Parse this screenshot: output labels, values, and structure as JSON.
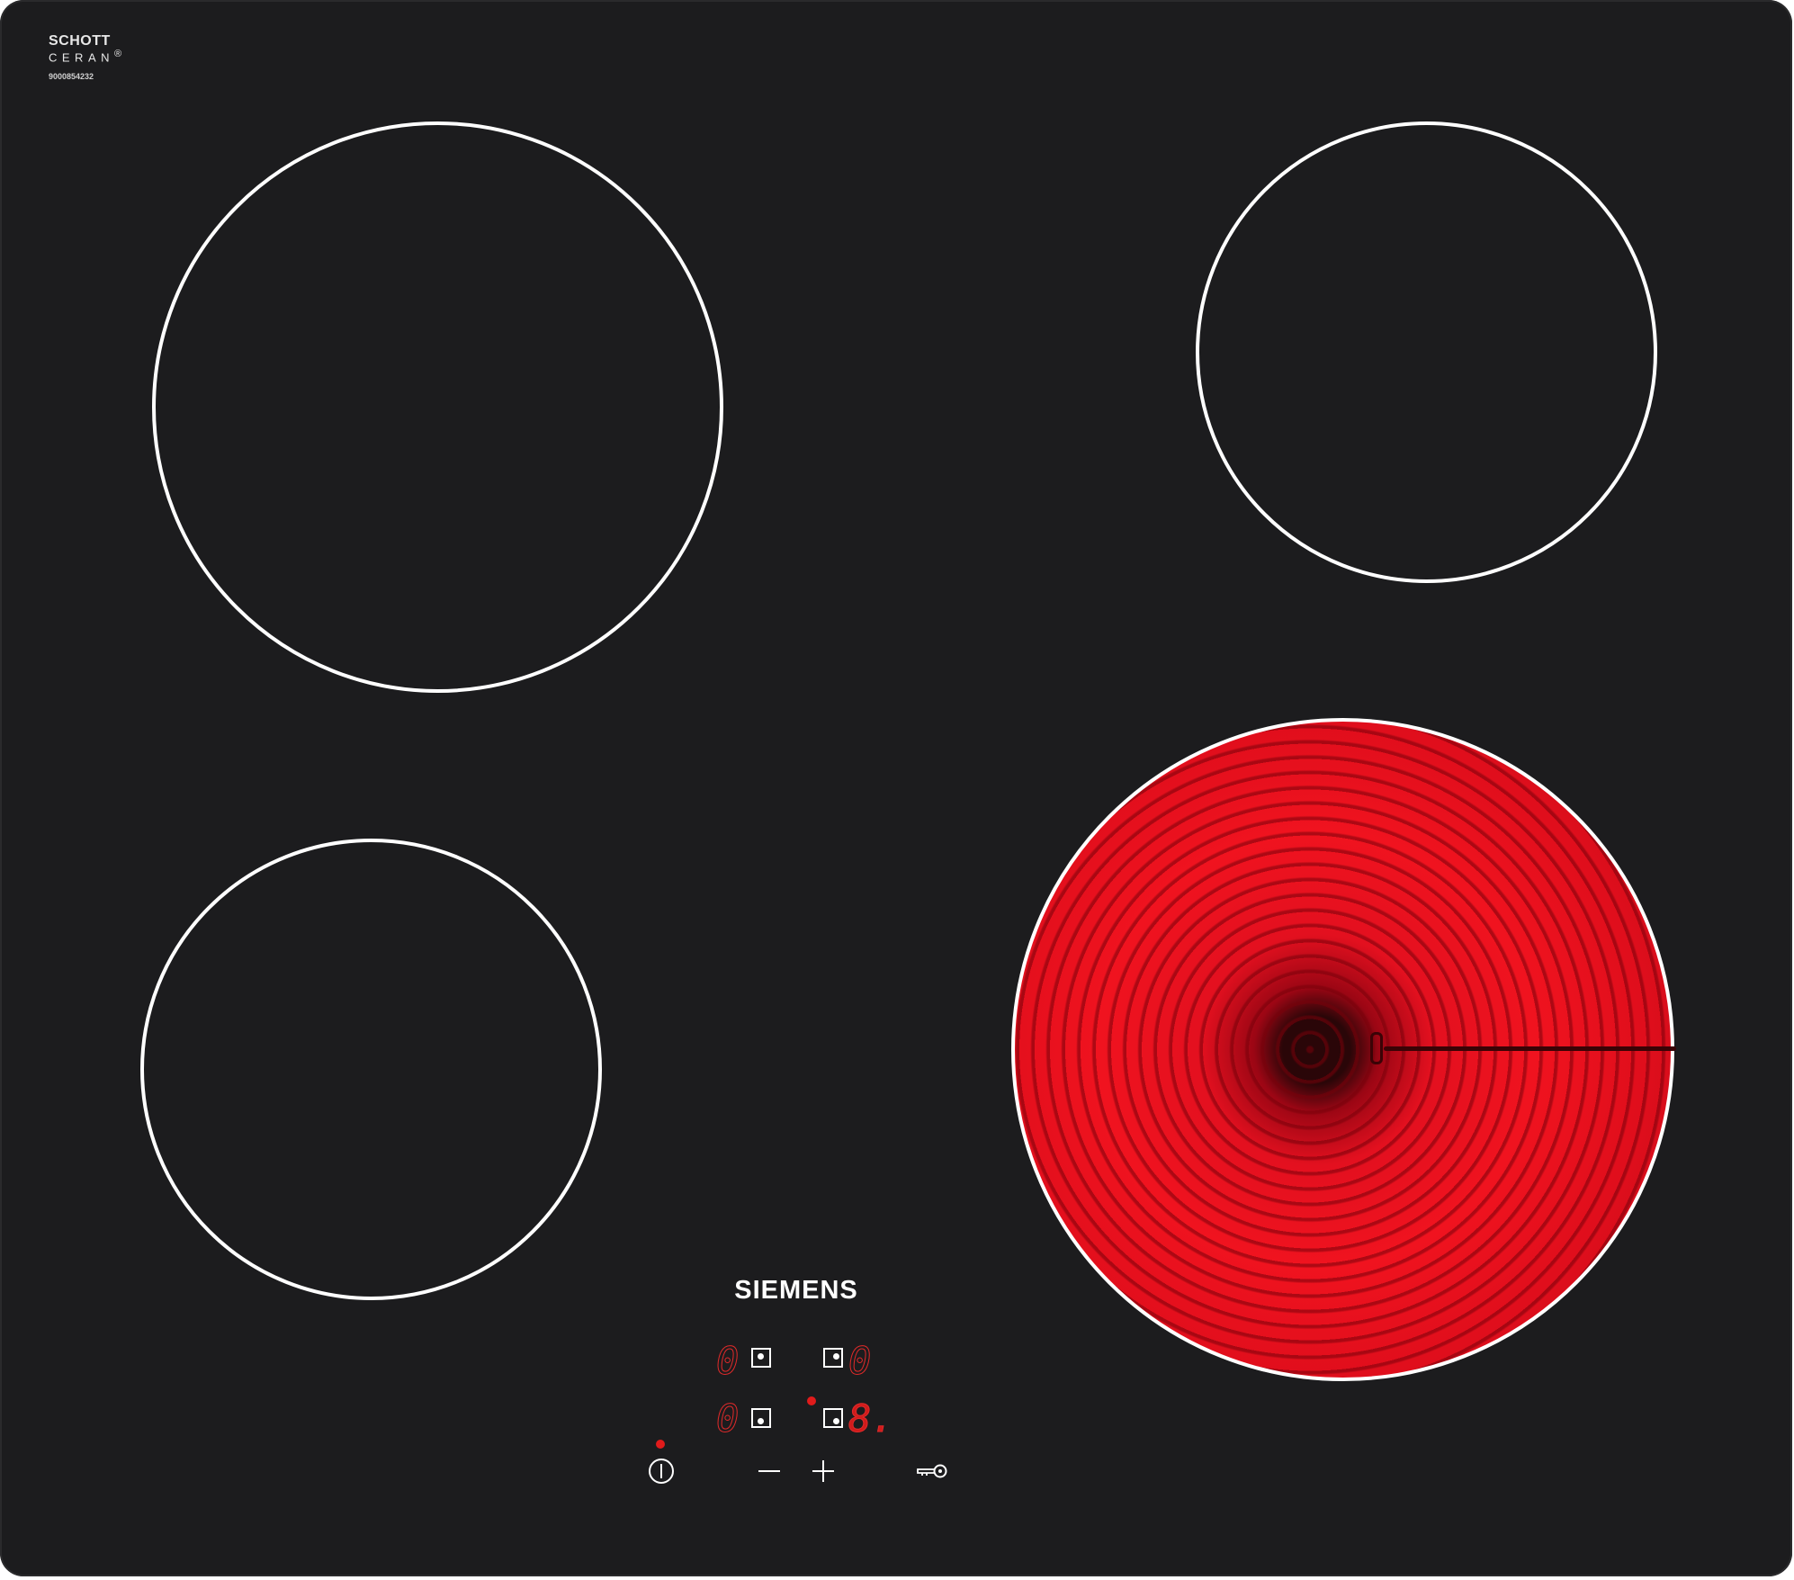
{
  "glass_label": {
    "line1": "SCHOTT",
    "line2": "CERAN",
    "registered": "®",
    "serial": "9000854232"
  },
  "brand": "SIEMENS",
  "zones": [
    {
      "id": "front-left",
      "state": "off"
    },
    {
      "id": "rear-right",
      "state": "off"
    },
    {
      "id": "rear-left",
      "state": "off"
    },
    {
      "id": "front-right",
      "state": "glowing"
    }
  ],
  "controls": {
    "displays": [
      {
        "id": "top-left",
        "value": "0"
      },
      {
        "id": "top-right",
        "value": "0"
      },
      {
        "id": "bottom-left",
        "value": "0"
      },
      {
        "id": "bottom-right",
        "value": "8."
      }
    ],
    "buttons": [
      "power-icon",
      "minus-icon",
      "plus-icon",
      "childlock-key-icon"
    ]
  },
  "colors": {
    "glass": "#1c1c1e",
    "zone_outline": "#ffffff",
    "heat_glow": "#e3101f",
    "display_red": "#e02a2a"
  }
}
